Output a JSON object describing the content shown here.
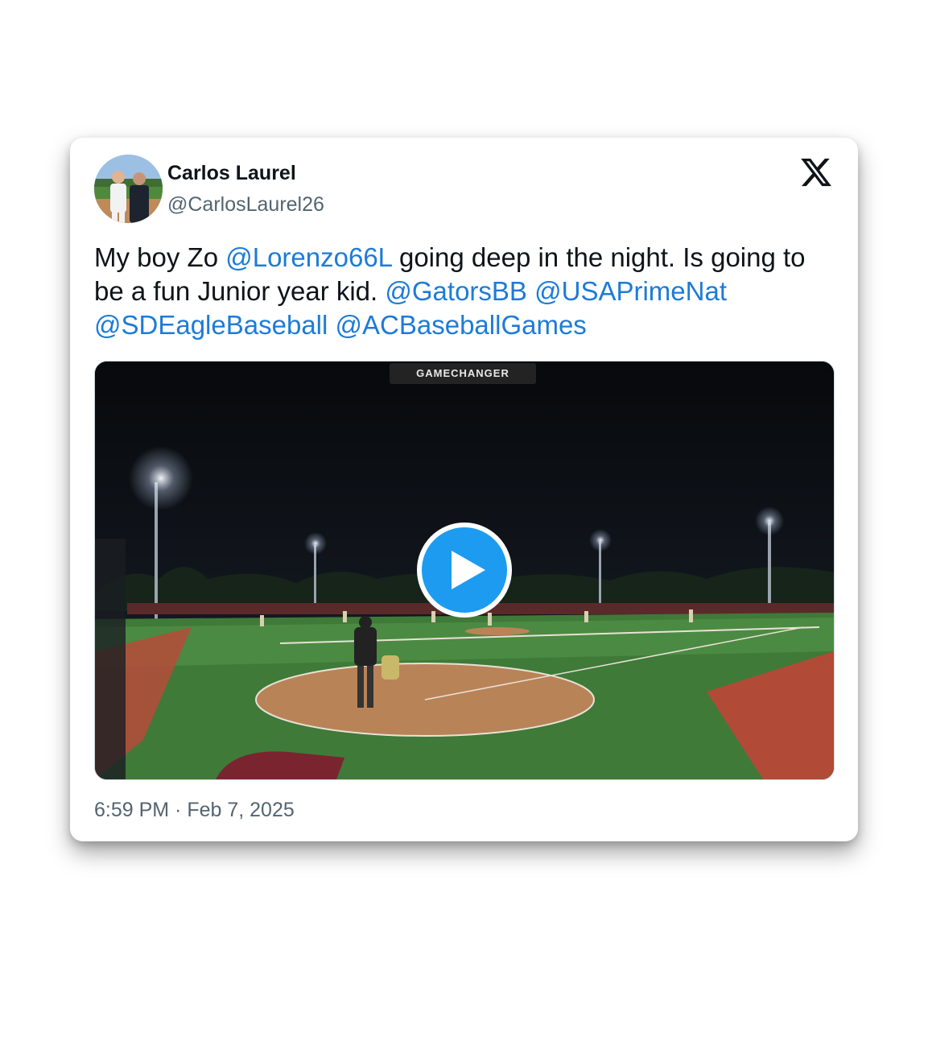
{
  "tweet": {
    "author_name": "Carlos Laurel",
    "author_handle": "@CarlosLaurel26",
    "text_parts": {
      "p1": "My boy Zo ",
      "m1": "@Lorenzo66L",
      "p2": "  going deep in the night. Is going to be a fun Junior year kid. ",
      "m2": "@GatorsBB",
      "m3": "@USAPrimeNat",
      "m4": "@SDEagleBaseball",
      "m5": "@ACBaseballGames"
    },
    "media": {
      "watermark": "GAMECHANGER",
      "type": "video"
    },
    "timestamp": "6:59 PM · Feb 7, 2025"
  },
  "icons": {
    "platform_logo": "x-logo-icon",
    "play": "play-icon"
  },
  "colors": {
    "mention": "#1d7bd8",
    "play_button": "#1d9bf0",
    "text": "#0f1419",
    "muted": "#536471"
  }
}
